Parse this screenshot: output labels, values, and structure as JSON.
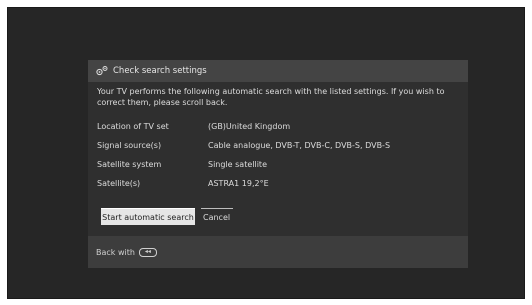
{
  "dialog": {
    "title": "Check search settings",
    "icon": "gears-icon",
    "intro": "Your TV performs the following automatic search with the listed settings. If you wish to correct them, please scroll back.",
    "settings": [
      {
        "label": "Location of TV set",
        "value": "(GB)United Kingdom"
      },
      {
        "label": "Signal source(s)",
        "value": "Cable analogue, DVB-T, DVB-C, DVB-S, DVB-S"
      },
      {
        "label": "Satellite system",
        "value": "Single satellite"
      },
      {
        "label": "Satellite(s)",
        "value": "ASTRA1 19,2°E"
      }
    ],
    "start_button": "Start automatic search",
    "cancel_button": "Cancel"
  },
  "footer": {
    "back_text": "Back with",
    "back_icon": "back-button-icon",
    "back_icon_glyph": "◂◂"
  }
}
